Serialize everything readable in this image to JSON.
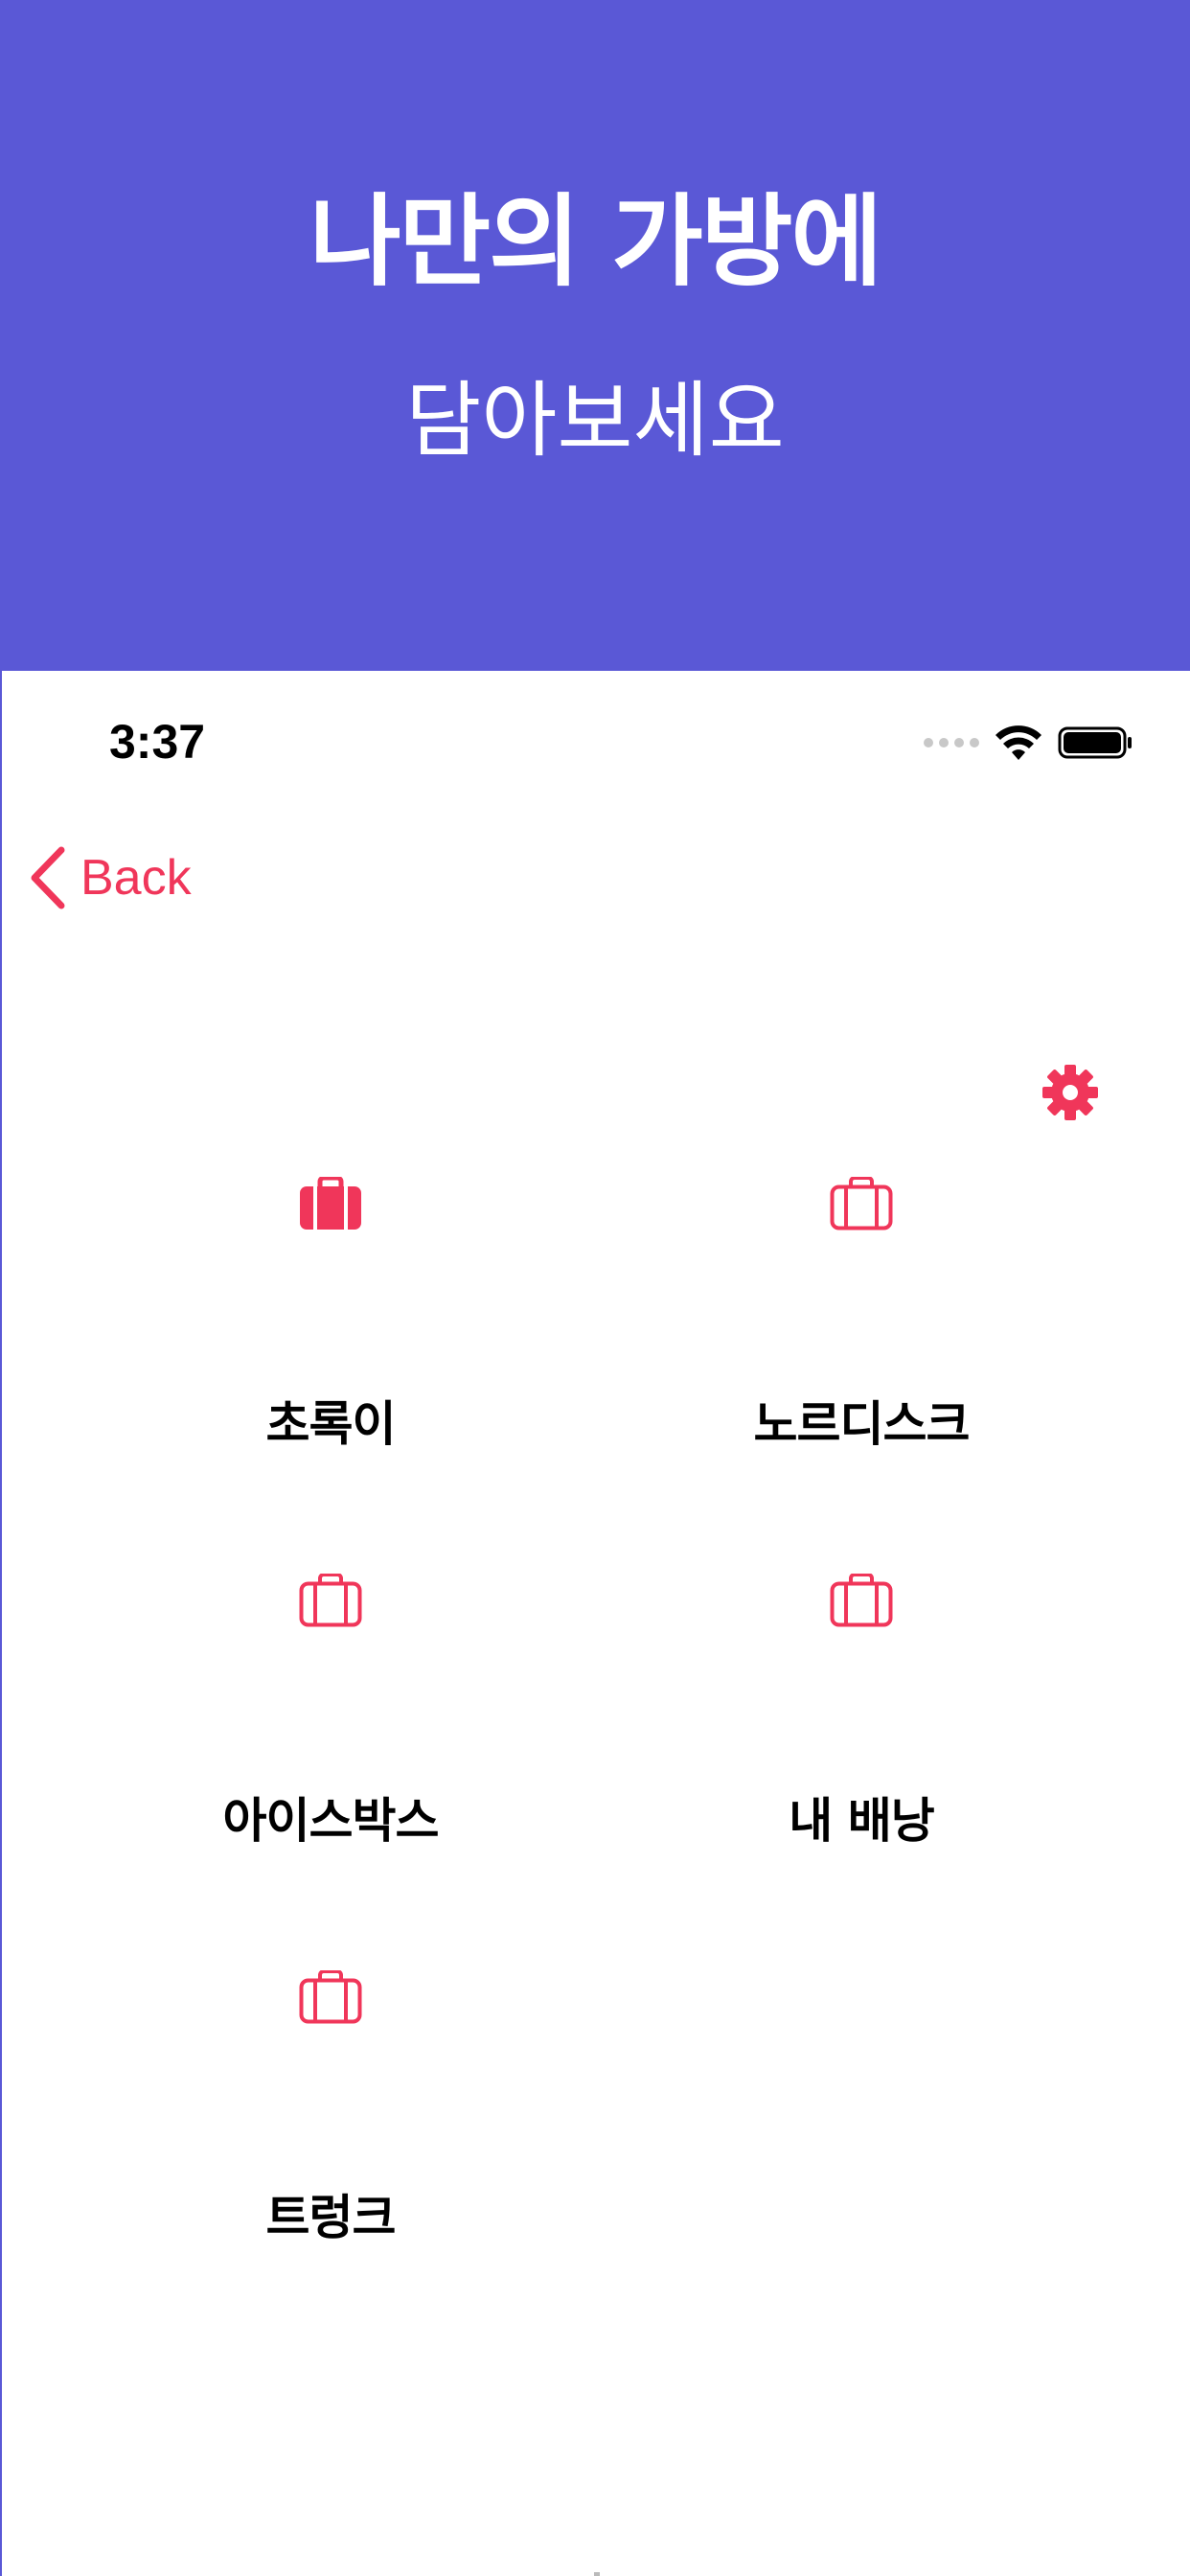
{
  "promo": {
    "headline": "나만의 가방에",
    "subheadline": "담아보세요"
  },
  "status_bar": {
    "time": "3:37"
  },
  "nav": {
    "back_label": "Back"
  },
  "colors": {
    "accent": "#F0365A",
    "promo_background": "#5A58D6"
  },
  "bags": [
    {
      "name": "초록이",
      "icon": "briefcase-filled-icon",
      "selected": true
    },
    {
      "name": "노르디스크",
      "icon": "briefcase-outline-icon",
      "selected": false
    },
    {
      "name": "아이스박스",
      "icon": "briefcase-outline-icon",
      "selected": false
    },
    {
      "name": "내 배낭",
      "icon": "briefcase-outline-icon",
      "selected": false
    },
    {
      "name": "트렁크",
      "icon": "briefcase-outline-icon",
      "selected": false
    }
  ],
  "settings_icon": "gear-icon"
}
